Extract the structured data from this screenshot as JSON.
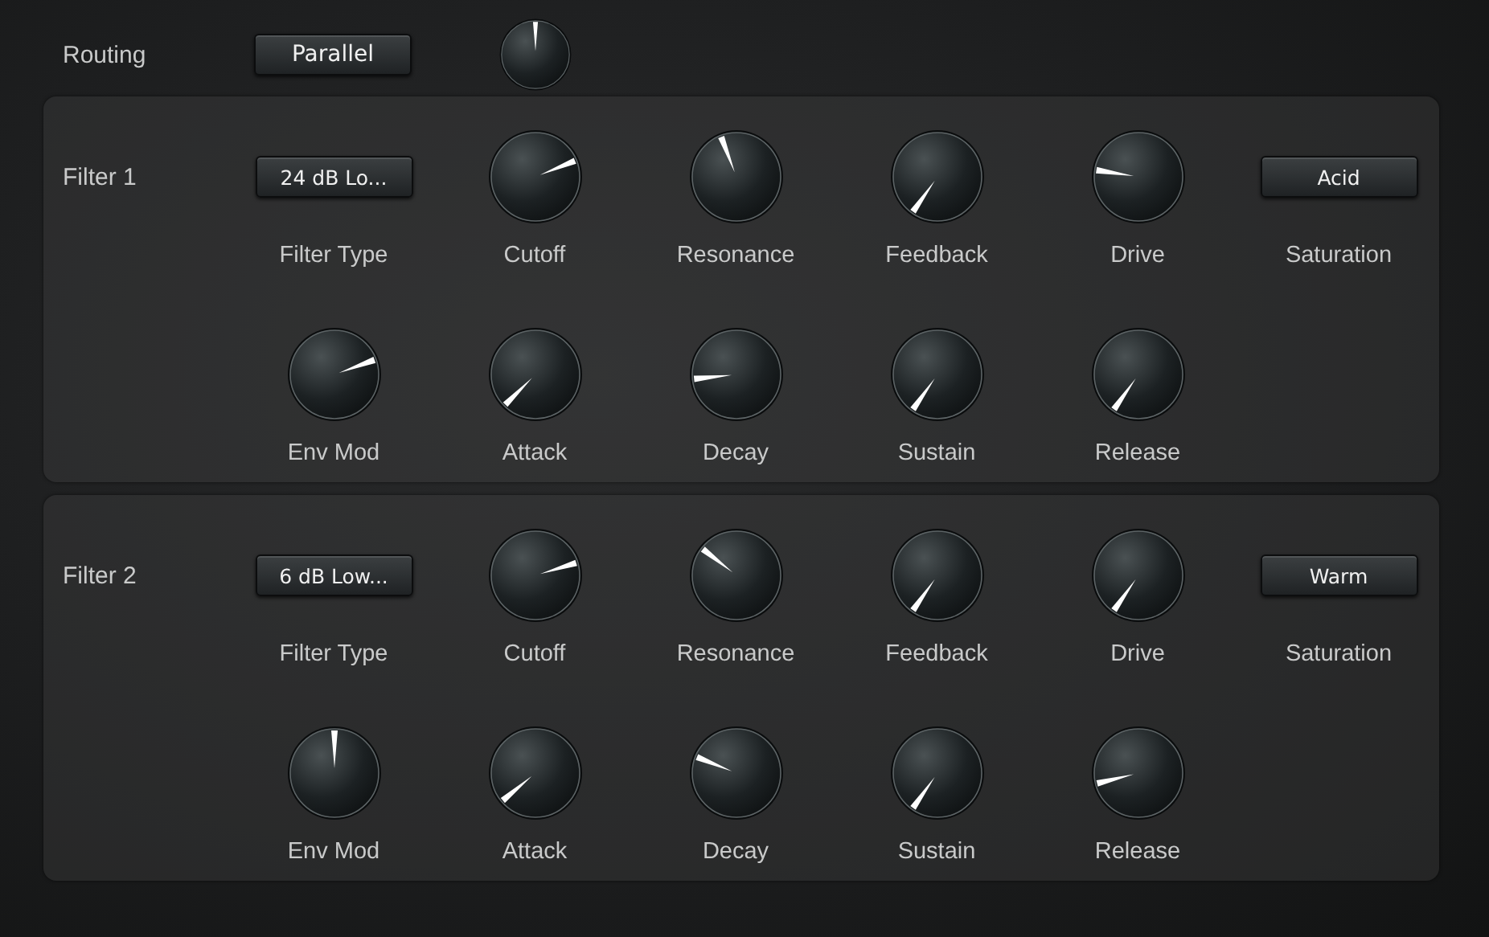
{
  "routing": {
    "label": "Routing",
    "value": "Parallel",
    "knob": {
      "kind": "knob"
    }
  },
  "filters": [
    {
      "label": "Filter 1",
      "rows": [
        [
          {
            "kind": "dropdown",
            "label": "Filter Type",
            "value": "24 dB Lo..."
          },
          {
            "kind": "knob",
            "label": "Cutoff"
          },
          {
            "kind": "knob",
            "label": "Resonance"
          },
          {
            "kind": "knob",
            "label": "Feedback"
          },
          {
            "kind": "knob",
            "label": "Drive"
          },
          {
            "kind": "dropdown",
            "label": "Saturation",
            "value": "Acid"
          }
        ],
        [
          {
            "kind": "knob",
            "label": "Env Mod"
          },
          {
            "kind": "knob",
            "label": "Attack"
          },
          {
            "kind": "knob",
            "label": "Decay"
          },
          {
            "kind": "knob",
            "label": "Sustain"
          },
          {
            "kind": "knob",
            "label": "Release"
          }
        ]
      ]
    },
    {
      "label": "Filter 2",
      "rows": [
        [
          {
            "kind": "dropdown",
            "label": "Filter Type",
            "value": "6 dB Low..."
          },
          {
            "kind": "knob",
            "label": "Cutoff"
          },
          {
            "kind": "knob",
            "label": "Resonance"
          },
          {
            "kind": "knob",
            "label": "Feedback"
          },
          {
            "kind": "knob",
            "label": "Drive"
          },
          {
            "kind": "dropdown",
            "label": "Saturation",
            "value": "Warm"
          }
        ],
        [
          {
            "kind": "knob",
            "label": "Env Mod"
          },
          {
            "kind": "knob",
            "label": "Attack"
          },
          {
            "kind": "knob",
            "label": "Decay"
          },
          {
            "kind": "knob",
            "label": "Sustain"
          },
          {
            "kind": "knob",
            "label": "Release"
          }
        ]
      ]
    }
  ]
}
